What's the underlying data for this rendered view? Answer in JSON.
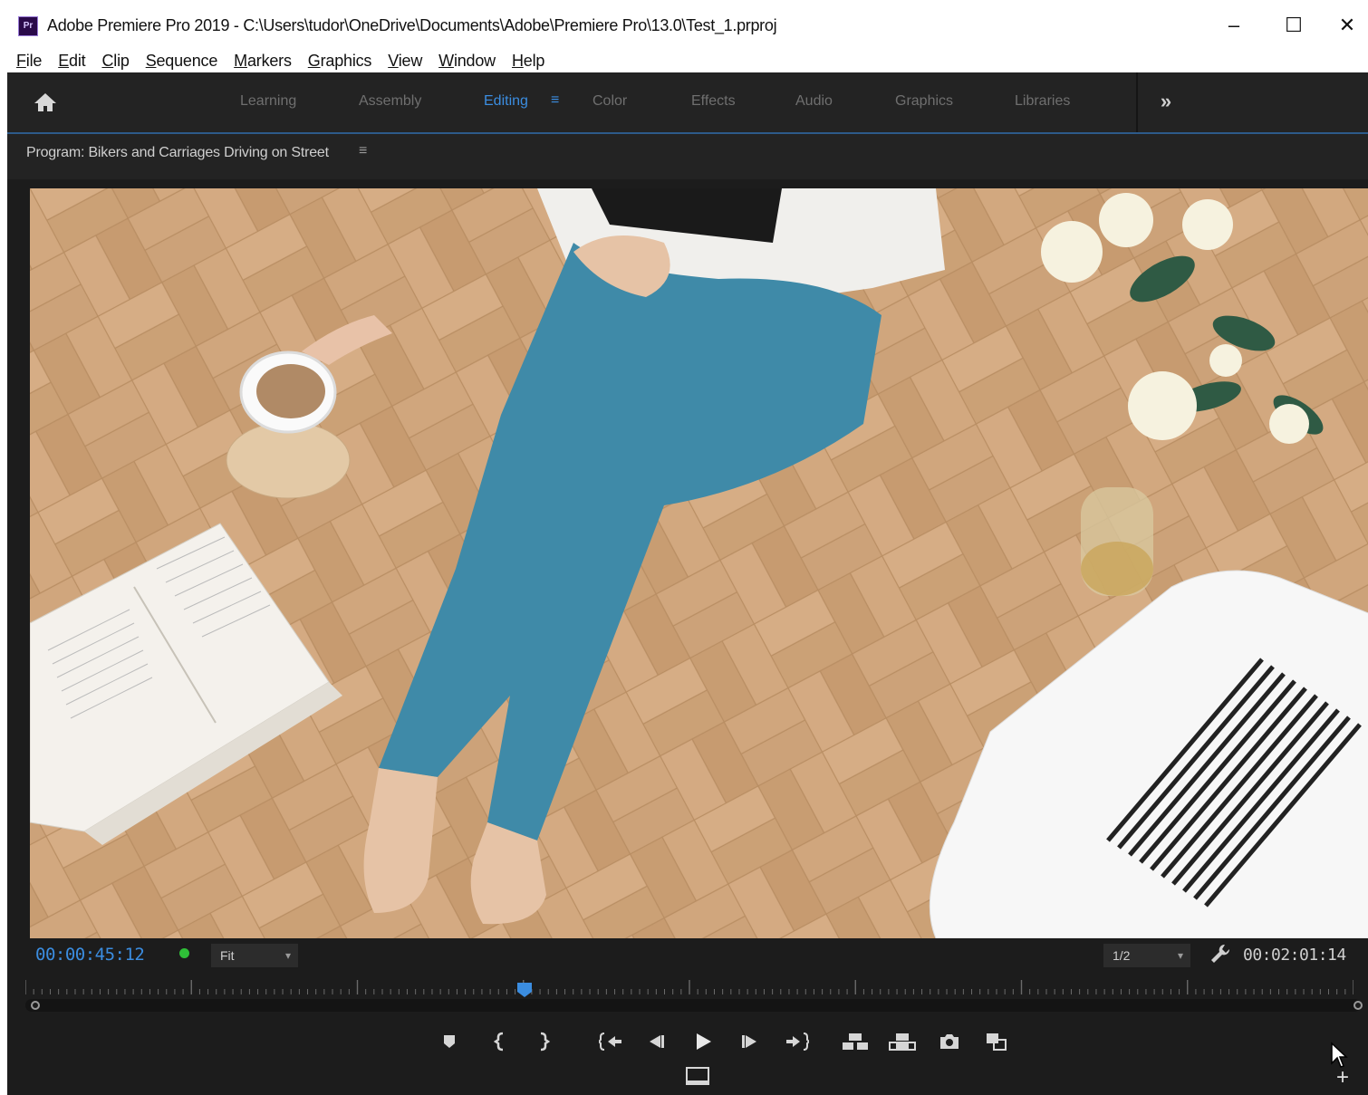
{
  "window": {
    "app_icon_text": "Pr",
    "title": "Adobe Premiere Pro 2019 - C:\\Users\\tudor\\OneDrive\\Documents\\Adobe\\Premiere Pro\\13.0\\Test_1.prproj",
    "minimize": "–",
    "maximize": "☐",
    "close": "✕"
  },
  "menu": [
    {
      "first": "F",
      "rest": "ile"
    },
    {
      "first": "E",
      "rest": "dit"
    },
    {
      "first": "C",
      "rest": "lip"
    },
    {
      "first": "S",
      "rest": "equence"
    },
    {
      "first": "M",
      "rest": "arkers"
    },
    {
      "first": "G",
      "rest": "raphics"
    },
    {
      "first": "V",
      "rest": "iew"
    },
    {
      "first": "W",
      "rest": "indow"
    },
    {
      "first": "H",
      "rest": "elp"
    }
  ],
  "workspaces": {
    "tabs": [
      "Learning",
      "Assembly",
      "Editing",
      "Color",
      "Effects",
      "Audio",
      "Graphics",
      "Libraries"
    ],
    "active": "Editing",
    "menu_icon": "≡",
    "more": "»"
  },
  "program": {
    "title": "Program: Bikers and Carriages Driving on Street",
    "menu_icon": "≡"
  },
  "controls": {
    "current_time": "00:00:45:12",
    "zoom": "Fit",
    "resolution": "1/2",
    "duration": "00:02:01:14",
    "playhead_fraction": 0.376,
    "plus": "+"
  },
  "icons": {
    "transport": [
      "add-marker-icon",
      "mark-in-icon",
      "mark-out-icon",
      "go-to-in-icon",
      "step-back-icon",
      "play-icon",
      "step-forward-icon",
      "go-to-out-icon",
      "insert-icon",
      "overwrite-icon",
      "export-frame-icon",
      "comparison-view-icon"
    ]
  },
  "colors": {
    "accent": "#3b8de0",
    "panel": "#1c1c1c",
    "status_green": "#2fbf38"
  }
}
